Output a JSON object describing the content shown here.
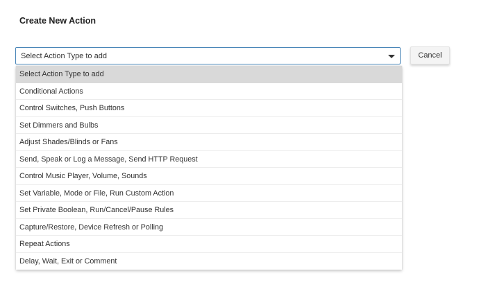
{
  "dialog": {
    "title": "Create New Action"
  },
  "action_select": {
    "selected_value": "Select Action Type to add",
    "options": [
      "Select Action Type to add",
      "Conditional Actions",
      "Control Switches, Push Buttons",
      "Set Dimmers and Bulbs",
      "Adjust Shades/Blinds or Fans",
      "Send, Speak or Log a Message, Send HTTP Request",
      "Control Music Player, Volume, Sounds",
      "Set Variable, Mode or File, Run Custom Action",
      "Set Private Boolean, Run/Cancel/Pause Rules",
      "Capture/Restore, Device Refresh or Polling",
      "Repeat Actions",
      "Delay, Wait, Exit or Comment"
    ]
  },
  "buttons": {
    "cancel_label": "Cancel"
  },
  "icons": {
    "dropdown_caret": "caret-down-icon"
  },
  "colors": {
    "select_border": "#4a86b8",
    "highlighted_option": "#d9d9d9"
  }
}
